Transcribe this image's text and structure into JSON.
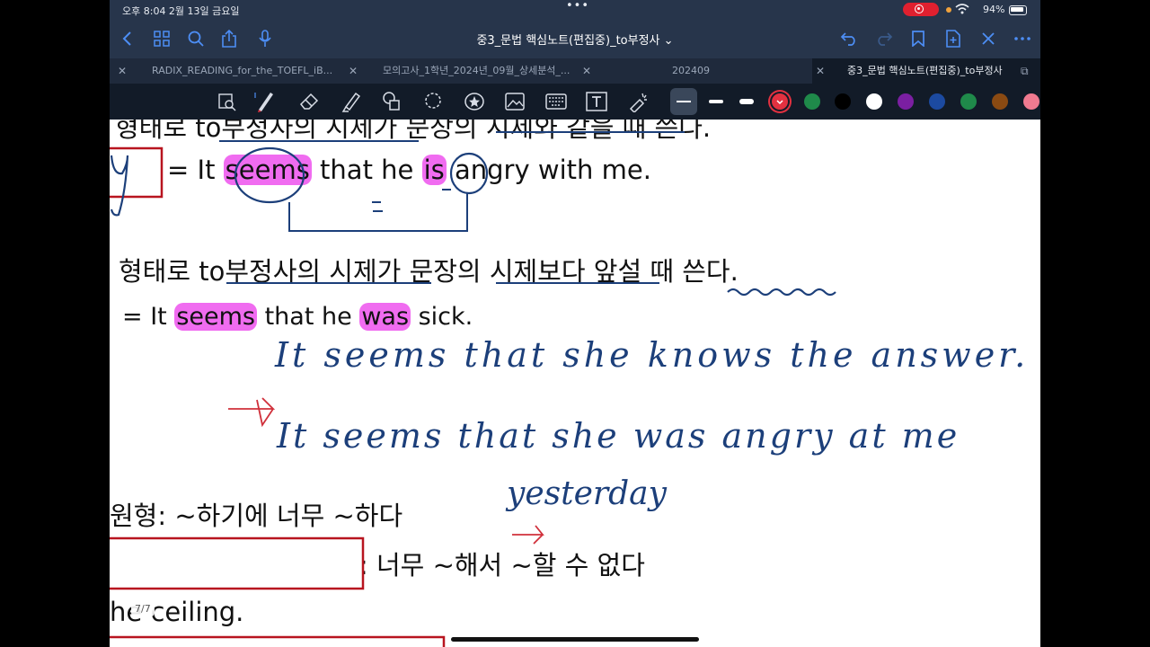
{
  "status_bar": {
    "time": "오후 8:04   2월 13일 금요일",
    "dots": "•••",
    "battery": "94%"
  },
  "nav": {
    "title": "중3_문법 핵심노트(편집중)_to부정사 ⌄"
  },
  "tabs": [
    {
      "label": "RADIX_READING_for_the_TOEFL_iB..."
    },
    {
      "label": "모의고사_1학년_2024년_09월_상세분석_..."
    },
    {
      "label": "202409"
    },
    {
      "label": "중3_문법 핵심노트(편집중)_to부정사"
    }
  ],
  "colors": {
    "chrome_bg": "#27354b",
    "accent": "#4d8ef5",
    "highlight": "#f06cf0",
    "ink_blue": "#1c3f7a",
    "ink_red": "#d0303b",
    "box_red": "#b8141f",
    "swatches": [
      "#e23140",
      "#1f8a4a",
      "#000000",
      "#ffffff",
      "#7b1fa2",
      "#1c4aa0",
      "#1f8a4a",
      "#8a4a12",
      "#f07a90"
    ]
  },
  "toolbar": {
    "icons": [
      "lasso-zoom-icon",
      "pen-icon",
      "eraser-icon",
      "highlighter-icon",
      "shapes-icon",
      "lasso-icon",
      "sticker-icon",
      "image-icon",
      "keyboard-icon",
      "text-icon",
      "laser-icon"
    ]
  },
  "page": {
    "line1": "형태로 to부정사의 시제가 문장의 시제와 같을 때 쓴다.",
    "line2_prefix": "= It ",
    "line2_hl1": "seems",
    "line2_mid": " that he ",
    "line2_hl2": "is",
    "line2_suffix": " angry with me.",
    "line3": "형태로 to부정사의 시제가 문장의 시제보다 앞설 때 쓴다.",
    "line4_prefix": "= It ",
    "line4_hl1": "seems",
    "line4_mid": " that he ",
    "line4_hl2": "was",
    "line4_suffix": " sick.",
    "line5": "원형: ~하기에 너무 ~하다",
    "line6": ": 너무 ~해서 ~할 수 없다",
    "line7": "he ceiling.",
    "page_indicator": "7/7",
    "handwriting": {
      "note1": "It seems that she knows the answer.",
      "note2": "It seems that she was angry at me",
      "note3": "yesterday",
      "equals": "="
    }
  }
}
